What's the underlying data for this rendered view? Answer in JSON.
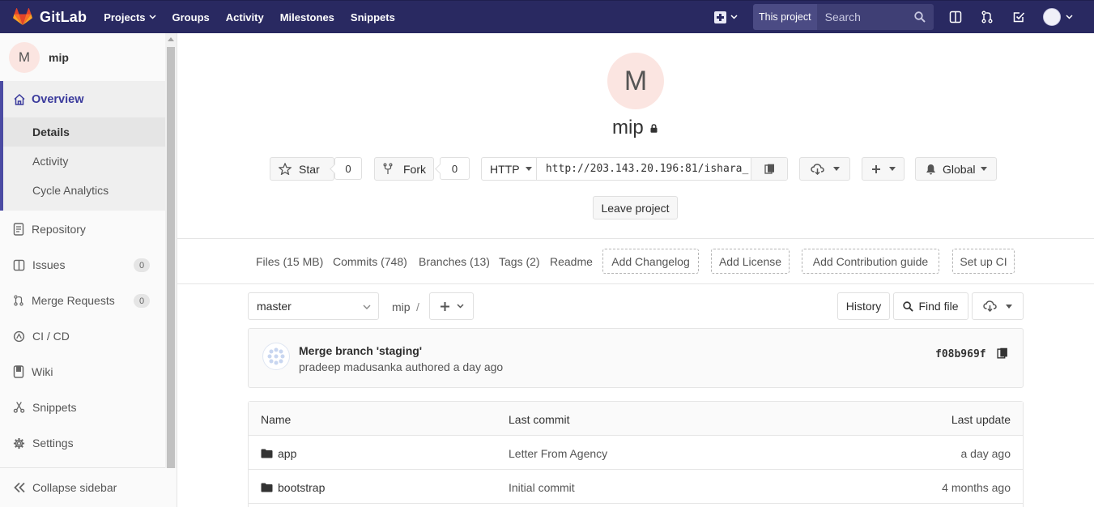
{
  "navbar": {
    "brand": "GitLab",
    "links": [
      {
        "label": "Projects",
        "dropdown": true
      },
      {
        "label": "Groups",
        "dropdown": false
      },
      {
        "label": "Activity",
        "dropdown": false
      },
      {
        "label": "Milestones",
        "dropdown": false
      },
      {
        "label": "Snippets",
        "dropdown": false
      }
    ],
    "search_scope": "This project",
    "search_placeholder": "Search",
    "colors": {
      "background": "#292961",
      "brand_orange": "#fc6d26"
    }
  },
  "sidebar": {
    "project_initial": "M",
    "project_name": "mip",
    "overview": {
      "label": "Overview",
      "items": [
        "Details",
        "Activity",
        "Cycle Analytics"
      ],
      "active_item": "Details"
    },
    "items": [
      {
        "label": "Repository",
        "icon": "repository-icon",
        "badge": null
      },
      {
        "label": "Issues",
        "icon": "issues-icon",
        "badge": "0"
      },
      {
        "label": "Merge Requests",
        "icon": "merge-request-icon",
        "badge": "0"
      },
      {
        "label": "CI / CD",
        "icon": "ci-cd-icon",
        "badge": null
      },
      {
        "label": "Wiki",
        "icon": "wiki-icon",
        "badge": null
      },
      {
        "label": "Snippets",
        "icon": "snippets-icon",
        "badge": null
      },
      {
        "label": "Settings",
        "icon": "settings-icon",
        "badge": null
      }
    ],
    "collapse_label": "Collapse sidebar"
  },
  "project": {
    "initial": "M",
    "name": "mip",
    "star_label": "Star",
    "star_count": "0",
    "fork_label": "Fork",
    "fork_count": "0",
    "clone_protocol": "HTTP",
    "clone_url": "http://203.143.20.196:81/ishara_",
    "notification_label": "Global",
    "leave_label": "Leave project"
  },
  "stats": {
    "files": "Files (15 MB)",
    "commits": "Commits (748)",
    "branches": "Branches (13)",
    "tags": "Tags (2)",
    "readme": "Readme",
    "add_changelog": "Add Changelog",
    "add_license": "Add License",
    "add_contribution": "Add Contribution guide",
    "setup_ci": "Set up CI"
  },
  "repo": {
    "branch": "master",
    "path_root": "mip",
    "path_sep": "/",
    "history_label": "History",
    "find_file_label": "Find file"
  },
  "commit": {
    "message": "Merge branch 'staging'",
    "author_line": "pradeep madusanka authored a day ago",
    "sha": "f08b969f"
  },
  "tree": {
    "headers": {
      "name": "Name",
      "last_commit": "Last commit",
      "last_update": "Last update"
    },
    "rows": [
      {
        "name": "app",
        "commit": "Letter From Agency",
        "updated": "a day ago"
      },
      {
        "name": "bootstrap",
        "commit": "Initial commit",
        "updated": "4 months ago"
      }
    ]
  }
}
